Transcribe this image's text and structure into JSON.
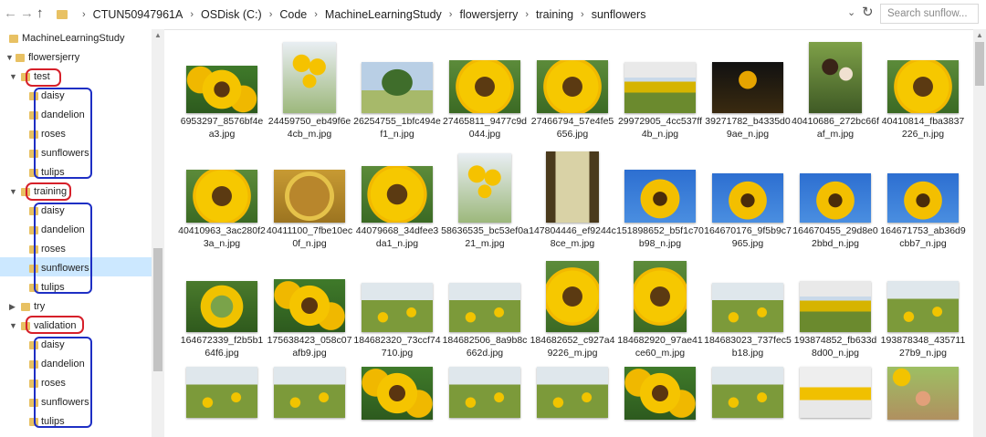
{
  "address_bar": {
    "back_icon": "arrow-left-icon",
    "forward_icon": "arrow-right-icon",
    "up_icon": "arrow-up-icon",
    "crumbs": [
      "CTUN50947961A",
      "OSDisk (C:)",
      "Code",
      "MachineLearningStudy",
      "flowersjerry",
      "training",
      "sunflowers"
    ],
    "search_placeholder": "Search sunflow..."
  },
  "tree": {
    "root": "MachineLearningStudy",
    "project": "flowersjerry",
    "test": "test",
    "test_children": [
      "daisy",
      "dandelion",
      "roses",
      "sunflowers",
      "tulips"
    ],
    "training": "training",
    "training_children": [
      "daisy",
      "dandelion",
      "roses",
      "sunflowers",
      "tulips"
    ],
    "try": "try",
    "validation": "validation",
    "validation_children": [
      "daisy",
      "dandelion",
      "roses",
      "sunflowers",
      "tulips"
    ],
    "selected": "sunflowers",
    "colors": {
      "highlight_red": "#d6202a",
      "highlight_blue": "#1e2fc4",
      "selection": "#cce8ff"
    }
  },
  "files": [
    {
      "name": "6953297_8576bf4ea3.jpg"
    },
    {
      "name": "24459750_eb49f6e4cb_m.jpg"
    },
    {
      "name": "26254755_1bfc494ef1_n.jpg"
    },
    {
      "name": "27465811_9477c9d044.jpg"
    },
    {
      "name": "27466794_57e4fe5656.jpg"
    },
    {
      "name": "29972905_4cc537ff4b_n.jpg"
    },
    {
      "name": "39271782_b4335d09ae_n.jpg"
    },
    {
      "name": "40410686_272bc66faf_m.jpg"
    },
    {
      "name": "40410814_fba3837226_n.jpg"
    },
    {
      "name": "40410963_3ac280f23a_n.jpg"
    },
    {
      "name": "40411100_7fbe10ec0f_n.jpg"
    },
    {
      "name": "44079668_34dfee3da1_n.jpg"
    },
    {
      "name": "58636535_bc53ef0a21_m.jpg"
    },
    {
      "name": "147804446_ef9244c8ce_m.jpg"
    },
    {
      "name": "151898652_b5f1c70b98_n.jpg"
    },
    {
      "name": "164670176_9f5b9c7965.jpg"
    },
    {
      "name": "164670455_29d8e02bbd_n.jpg"
    },
    {
      "name": "164671753_ab36d9cbb7_n.jpg"
    },
    {
      "name": "164672339_f2b5b164f6.jpg"
    },
    {
      "name": "175638423_058c07afb9.jpg"
    },
    {
      "name": "184682320_73ccf74710.jpg"
    },
    {
      "name": "184682506_8a9b8c662d.jpg"
    },
    {
      "name": "184682652_c927a49226_m.jpg"
    },
    {
      "name": "184682920_97ae41ce60_m.jpg"
    },
    {
      "name": "184683023_737fec5b18.jpg"
    },
    {
      "name": "193874852_fb633d8d00_n.jpg"
    },
    {
      "name": "193878348_43571127b9_n.jpg"
    },
    {
      "name": ""
    },
    {
      "name": ""
    },
    {
      "name": ""
    },
    {
      "name": ""
    },
    {
      "name": ""
    },
    {
      "name": ""
    },
    {
      "name": ""
    },
    {
      "name": ""
    },
    {
      "name": ""
    }
  ]
}
